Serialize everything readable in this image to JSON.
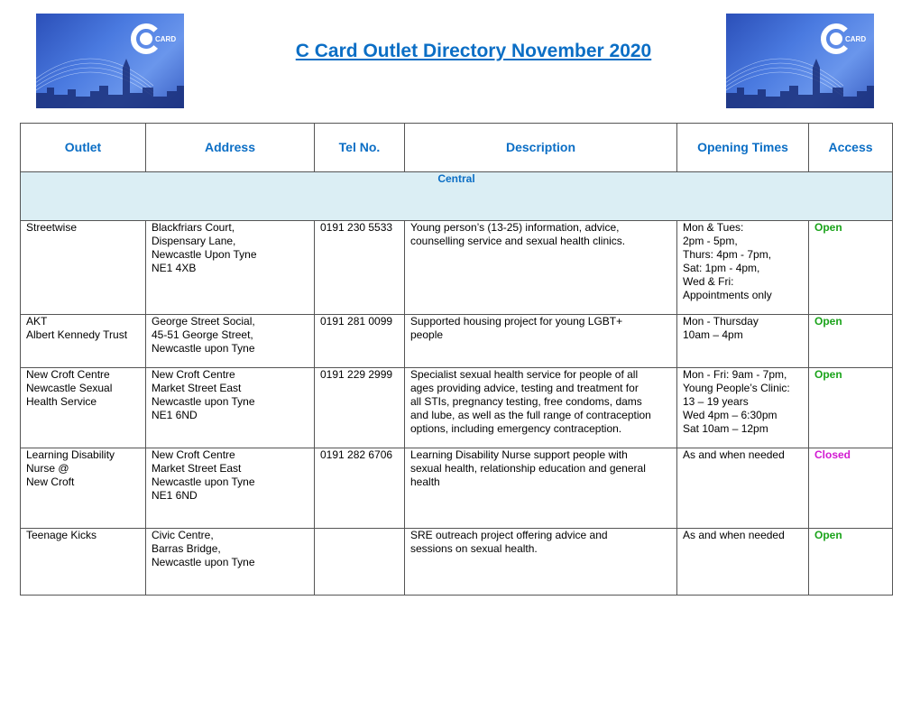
{
  "logo": {
    "text": "CARD",
    "letter": "C"
  },
  "title": "C Card Outlet Directory November 2020",
  "headers": [
    "Outlet",
    "Address",
    "Tel No.",
    "Description",
    "Opening Times",
    "Access"
  ],
  "region": "Central",
  "colors": {
    "heading": "#0b6ec5",
    "open": "#1aa31a",
    "closed": "#d21ad2",
    "region_bg": "#dbeef4"
  },
  "rows": [
    {
      "outlet": [
        "Streetwise"
      ],
      "address": [
        "Blackfriars Court,",
        "Dispensary Lane,",
        "Newcastle Upon Tyne",
        "NE1 4XB"
      ],
      "tel": "0191 230 5533",
      "description": [
        "Young person’s (13-25) information, advice,",
        "counselling service and sexual health clinics."
      ],
      "times": [
        "Mon & Tues:",
        "2pm - 5pm,",
        "Thurs: 4pm - 7pm,",
        "Sat: 1pm - 4pm,",
        "Wed & Fri:",
        "Appointments only"
      ],
      "access": "Open"
    },
    {
      "outlet": [
        "AKT",
        "Albert Kennedy Trust"
      ],
      "address": [
        "George Street Social,",
        "45-51 George Street,",
        "Newcastle upon Tyne"
      ],
      "tel": "0191 281 0099",
      "description": [
        "Supported housing project for young  LGBT+",
        "people"
      ],
      "times": [
        "Mon - Thursday",
        "10am – 4pm"
      ],
      "access": "Open"
    },
    {
      "outlet": [
        "New Croft Centre",
        "Newcastle Sexual",
        "Health Service"
      ],
      "address": [
        "New Croft Centre",
        "Market Street East",
        "Newcastle upon Tyne",
        "NE1 6ND"
      ],
      "tel": "0191 229 2999",
      "description": [
        "Specialist sexual health service for people of all",
        "ages providing advice, testing and treatment for",
        "all STIs, pregnancy testing, free condoms, dams",
        "and lube, as well as the full range of contraception",
        "options, including emergency contraception."
      ],
      "times": [
        "Mon - Fri: 9am - 7pm,",
        "Young People’s Clinic:",
        "13 – 19 years",
        "Wed 4pm – 6:30pm",
        "Sat 10am – 12pm"
      ],
      "access": "Open"
    },
    {
      "outlet": [
        "Learning Disability",
        "Nurse @",
        "New Croft"
      ],
      "address": [
        "New Croft Centre",
        "Market Street East",
        "Newcastle upon Tyne",
        "NE1 6ND"
      ],
      "tel": "0191 282 6706",
      "description": [
        "Learning Disability Nurse support people with",
        "sexual health, relationship education and general",
        "health"
      ],
      "times": [
        "As and when needed"
      ],
      "access": "Closed"
    },
    {
      "outlet": [
        "Teenage Kicks"
      ],
      "address": [
        "Civic Centre,",
        "Barras Bridge,",
        "Newcastle upon Tyne"
      ],
      "tel": "",
      "description": [
        "SRE outreach project offering advice and",
        "sessions on sexual health."
      ],
      "times": [
        "As and when needed"
      ],
      "access": "Open"
    }
  ]
}
